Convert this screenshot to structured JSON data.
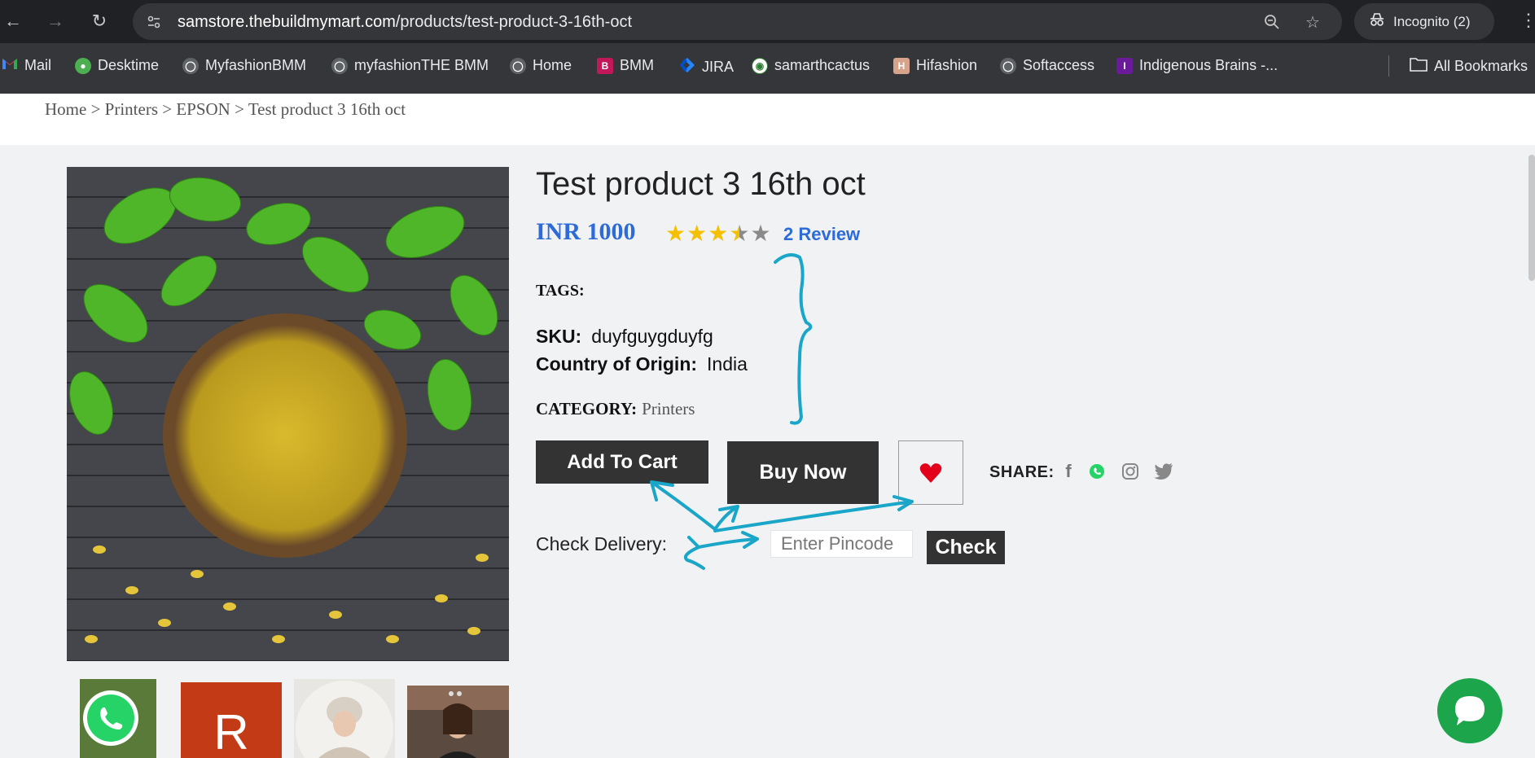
{
  "browser": {
    "url_host": "samstore.thebuildmymart.com",
    "url_path": "/products/test-product-3-16th-oct",
    "incognito_label": "Incognito (2)",
    "bookmarks": [
      {
        "label": "Mail",
        "icon": "gmail-icon"
      },
      {
        "label": "Desktime",
        "icon": "desktime-icon"
      },
      {
        "label": "MyfashionBMM",
        "icon": "globe-icon"
      },
      {
        "label": "myfashionTHE BMM",
        "icon": "globe-icon"
      },
      {
        "label": "Home",
        "icon": "globe-icon"
      },
      {
        "label": "BMM",
        "icon": "bmm-icon"
      },
      {
        "label": "JIRA",
        "icon": "jira-icon"
      },
      {
        "label": "samarthcactus",
        "icon": "cactus-icon"
      },
      {
        "label": "Hifashion",
        "icon": "hifashion-icon"
      },
      {
        "label": "Softaccess",
        "icon": "globe-icon"
      },
      {
        "label": "Indigenous Brains -...",
        "icon": "indigenous-icon"
      }
    ],
    "all_bookmarks_label": "All Bookmarks"
  },
  "breadcrumb": "Home > Printers > EPSON > Test product 3 16th oct",
  "product": {
    "title": "Test product 3 16th oct",
    "price": "INR 1000",
    "rating": 3.5,
    "rating_max": 5,
    "reviews_label": "2 Review",
    "tags_label": "TAGS:",
    "sku_label": "SKU:",
    "sku_value": "duyfguygduyfg",
    "origin_label": "Country of Origin:",
    "origin_value": "India",
    "category_label": "CATEGORY:",
    "category_value": "Printers"
  },
  "actions": {
    "add_to_cart": "Add To Cart",
    "buy_now": "Buy Now",
    "share_label": "SHARE:"
  },
  "delivery": {
    "label": "Check Delivery:",
    "pincode_placeholder": "Enter Pincode",
    "check_label": "Check"
  },
  "thumbnails": {
    "letter_thumb": "R"
  },
  "colors": {
    "accent_blue": "#2d6bd9",
    "star": "#f5c000",
    "annotation": "#1aa6c8",
    "whatsapp_green": "#1ca54a",
    "heart_red": "#e3001b"
  }
}
